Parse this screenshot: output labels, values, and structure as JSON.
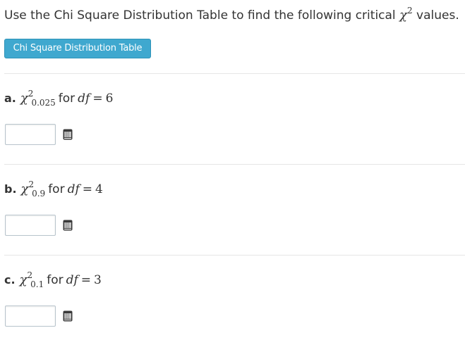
{
  "intro": {
    "text_before": "Use the Chi Square Distribution Table to find the following critical ",
    "chi_symbol": "χ",
    "chi_sup": "2",
    "text_after": " values."
  },
  "table_button": {
    "label": "Chi Square Distribution Table",
    "color": "#3fa8cf"
  },
  "questions": [
    {
      "letter": "a.",
      "chi_symbol": "χ",
      "sup": "2",
      "sub": "0.025",
      "for_text": "for",
      "df_label": "df",
      "equals": "=",
      "df_value": "6",
      "answer_value": "",
      "icon": "book-icon"
    },
    {
      "letter": "b.",
      "chi_symbol": "χ",
      "sup": "2",
      "sub": "0.9",
      "for_text": "for",
      "df_label": "df",
      "equals": "=",
      "df_value": "4",
      "answer_value": "",
      "icon": "book-icon"
    },
    {
      "letter": "c.",
      "chi_symbol": "χ",
      "sup": "2",
      "sub": "0.1",
      "for_text": "for",
      "df_label": "df",
      "equals": "=",
      "df_value": "3",
      "answer_value": "",
      "icon": "book-icon"
    }
  ]
}
